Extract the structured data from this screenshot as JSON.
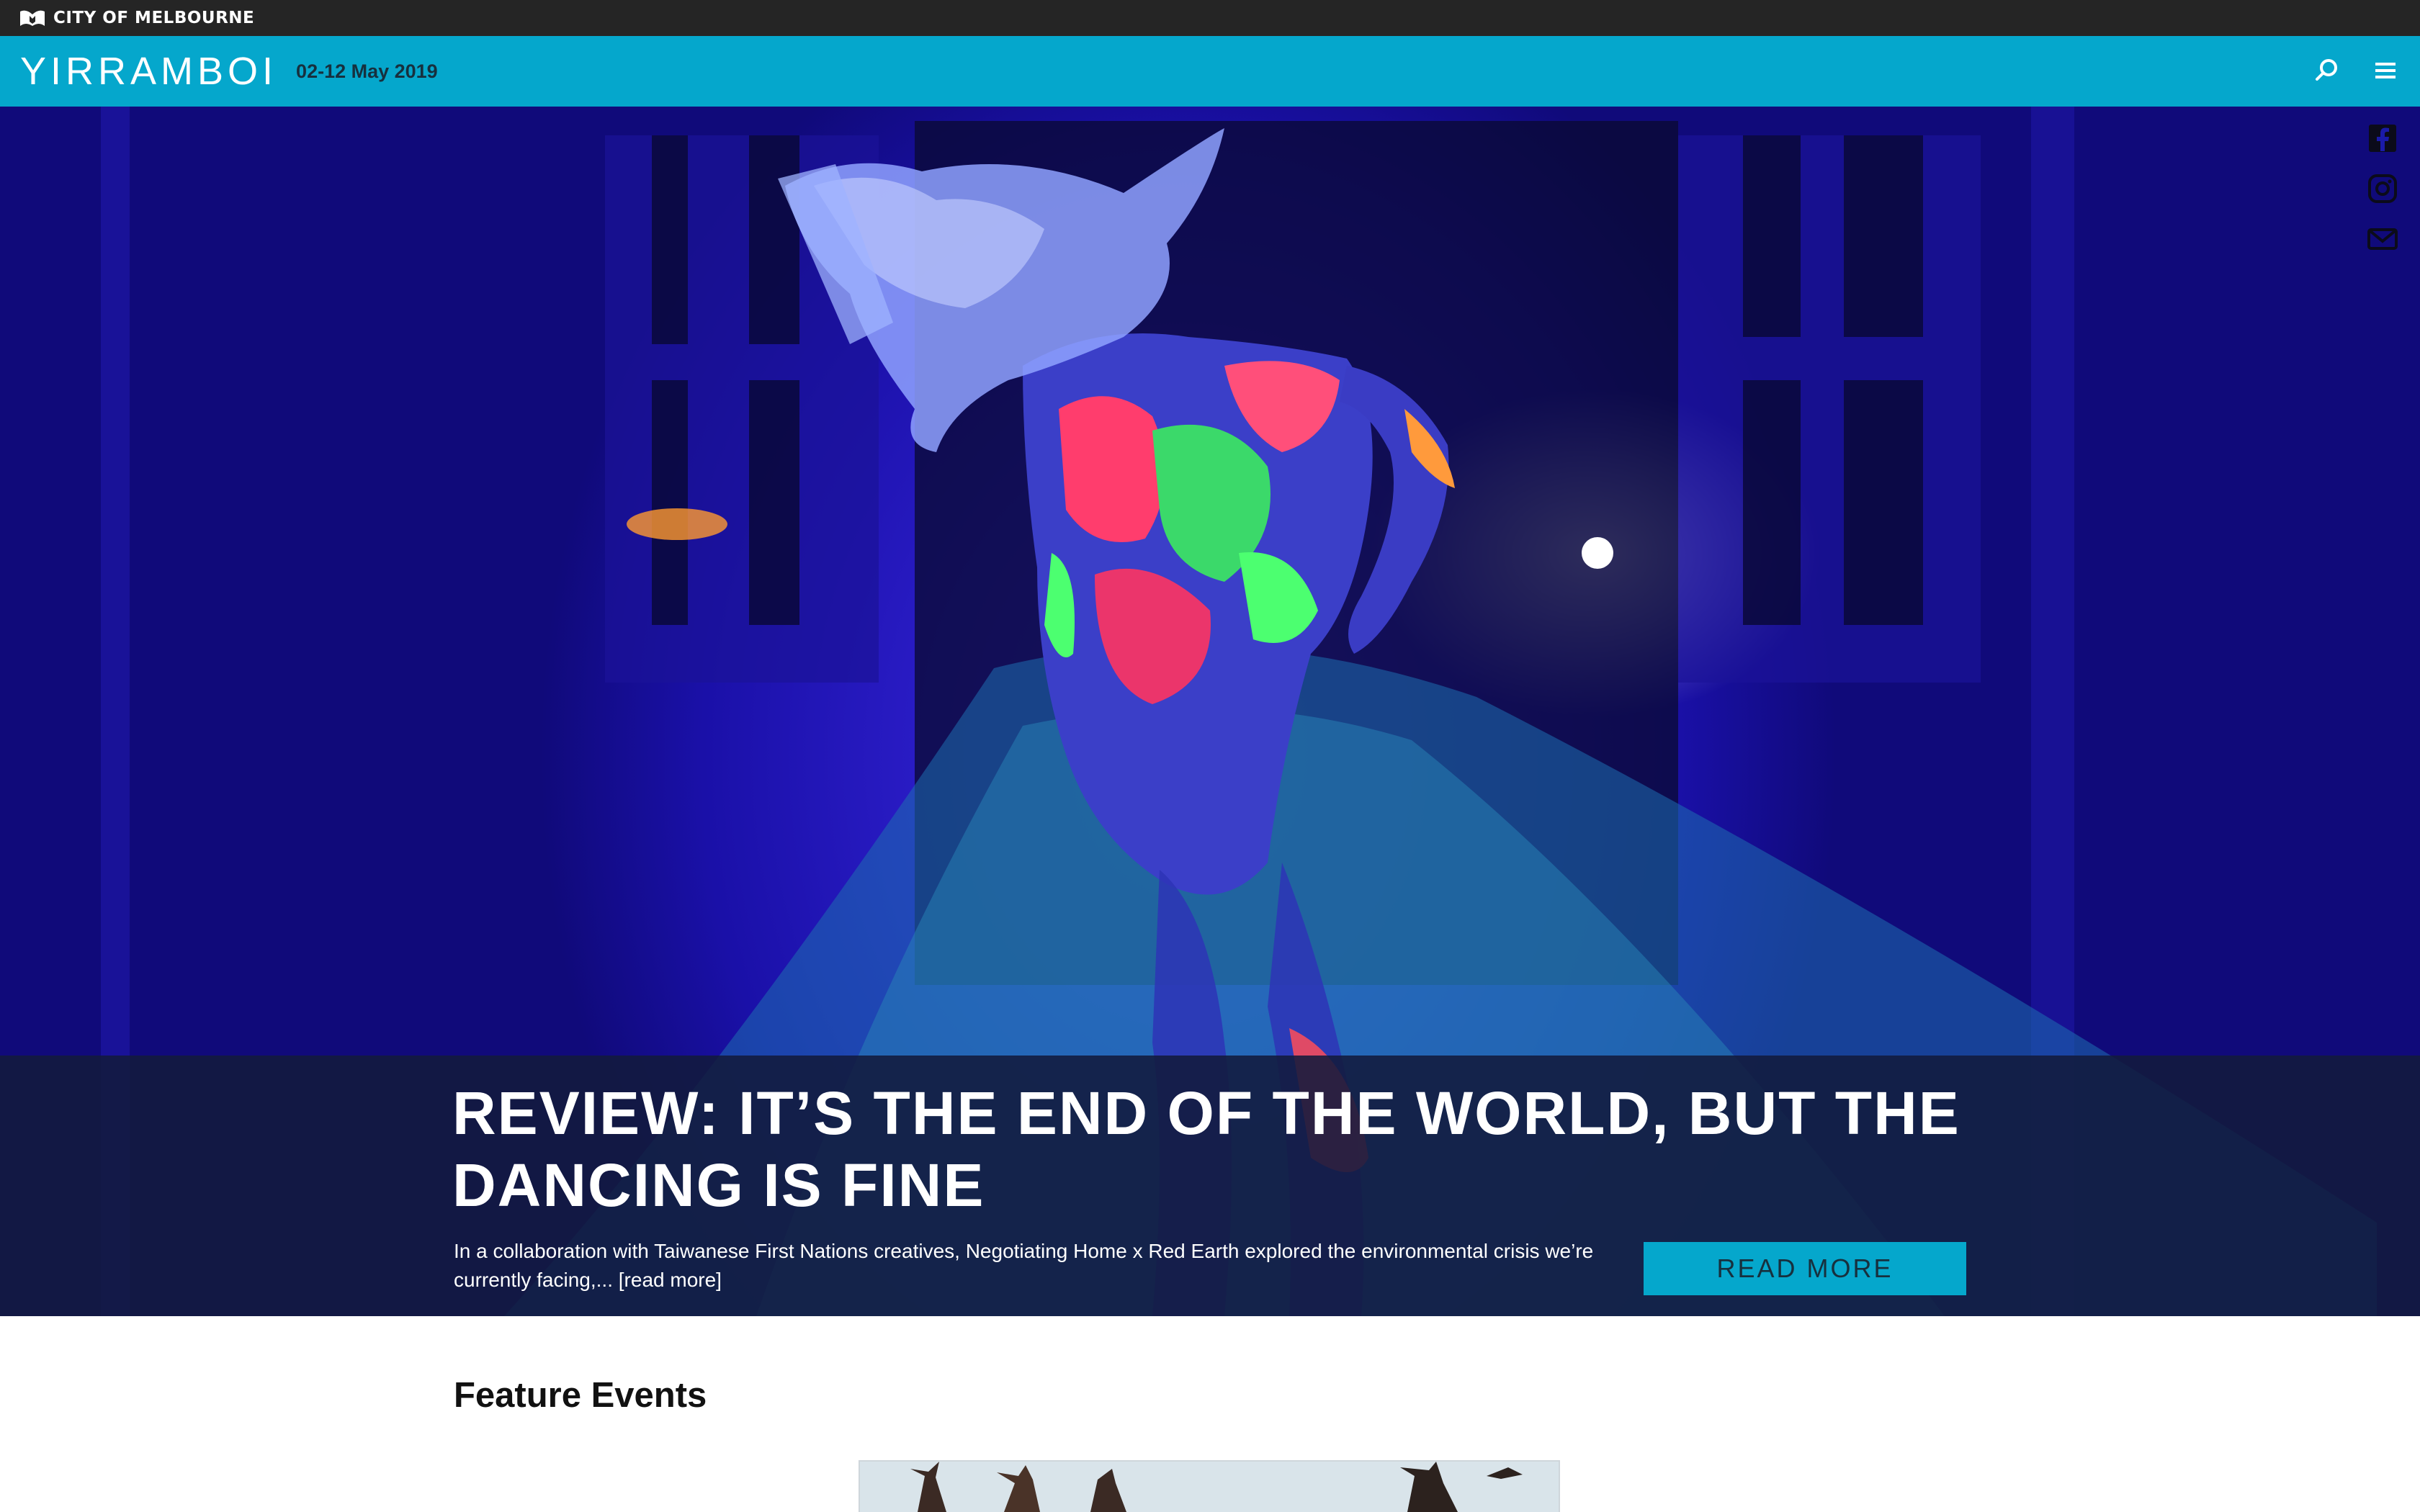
{
  "topbar": {
    "org_name": "CITY OF MELBOURNE",
    "logo_icon": "city-of-melbourne-m-icon"
  },
  "header": {
    "brand": "YIRRAMBOI",
    "dates": "02-12 May 2019",
    "search_icon": "search-icon",
    "menu_icon": "hamburger-menu-icon",
    "accent_color": "#05a7cc"
  },
  "social": {
    "items": [
      {
        "name": "Facebook",
        "icon": "facebook-icon"
      },
      {
        "name": "Instagram",
        "icon": "instagram-icon"
      },
      {
        "name": "Email",
        "icon": "email-icon"
      }
    ]
  },
  "hero": {
    "headline": "REVIEW: IT’S THE END OF THE WORLD, BUT THE DANCING IS FINE",
    "excerpt": "In a collaboration with Taiwanese First Nations creatives, Negotiating Home x Red Earth explored the environmental crisis we’re currently facing,...",
    "read_more_link": "[read more]",
    "read_more_button": "READ MORE"
  },
  "feature_events": {
    "title": "Feature Events"
  }
}
